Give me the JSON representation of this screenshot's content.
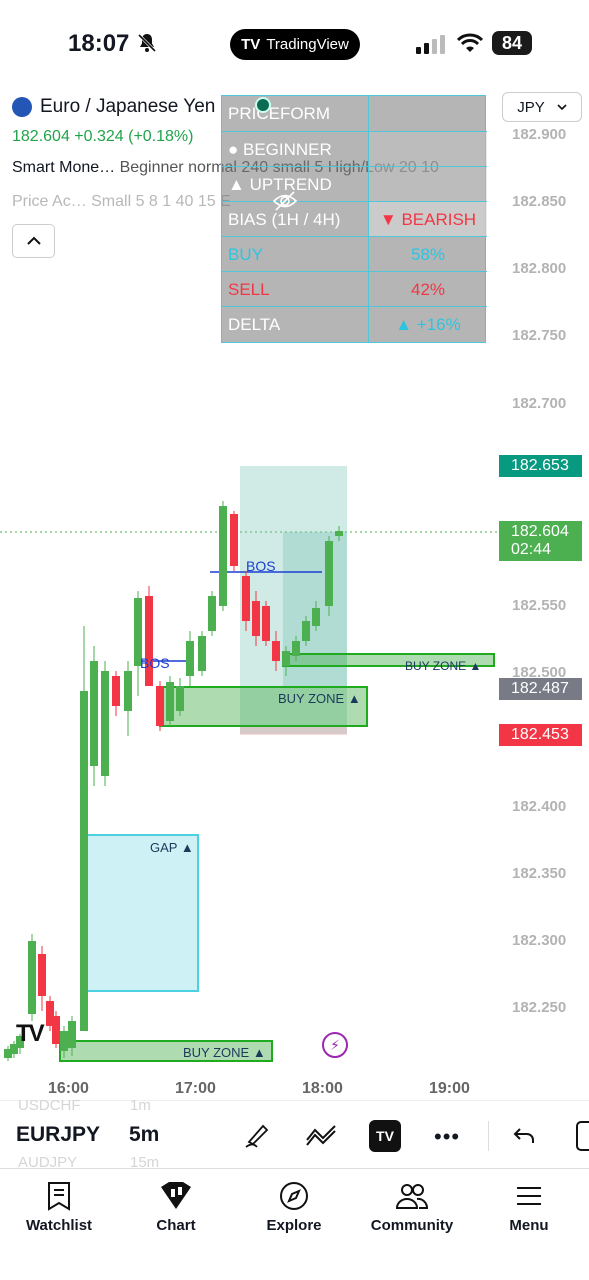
{
  "status": {
    "time": "18:07",
    "pill_label": "TradingView",
    "battery": "84"
  },
  "header": {
    "symbol_name": "Euro / Japanese Yen",
    "price_line": "182.604  +0.324 (+0.18%)",
    "indicator_1_name": "Smart Mone…",
    "indicator_1_params": " Beginner normal 240 small 5 High/Low 20 10",
    "indicator_2": "Price Ac… Small 5 8 1 40 15 E",
    "currency": "JPY"
  },
  "axis_labels": [
    "182.900",
    "182.850",
    "182.800",
    "182.750",
    "182.700",
    "182.550",
    "182.500",
    "182.400",
    "182.350",
    "182.300",
    "182.250"
  ],
  "price_tags": {
    "teal": "182.653",
    "green_price": "182.604",
    "green_countdown": "02:44",
    "gray": "182.487",
    "red": "182.453"
  },
  "overlay_table": {
    "title": "PRICEFORM",
    "row2": "BEGINNER",
    "row3": "UPTREND",
    "bias_label": "BIAS  (1H / 4H)",
    "bias_value": "BEARISH",
    "buy_label": "BUY",
    "buy_value": "58%",
    "sell_label": "SELL",
    "sell_value": "42%",
    "delta_label": "DELTA",
    "delta_value": "+16%"
  },
  "chart_labels": {
    "bos_1": "BOS",
    "bos_2": "BOS",
    "buy_zone_1": "BUY ZONE ▲",
    "buy_zone_2": "BUY ZONE ▲",
    "buy_zone_3": "BUY ZONE ▲",
    "gap": "GAP ▲"
  },
  "time_labels": [
    "16:00",
    "17:00",
    "18:00",
    "19:00"
  ],
  "toolbar": {
    "symbol": "EURJPY",
    "interval": "5m",
    "ghost_symbol_1": "USDCHF",
    "ghost_interval_1": "1m",
    "ghost_symbol_2": "AUDJPY",
    "ghost_interval_2": "15m"
  },
  "tabs": [
    "Watchlist",
    "Chart",
    "Explore",
    "Community",
    "Menu"
  ],
  "colors": {
    "up": "#4caf50",
    "down": "#f23645",
    "teal": "#089981",
    "accent": "#2962ff"
  }
}
